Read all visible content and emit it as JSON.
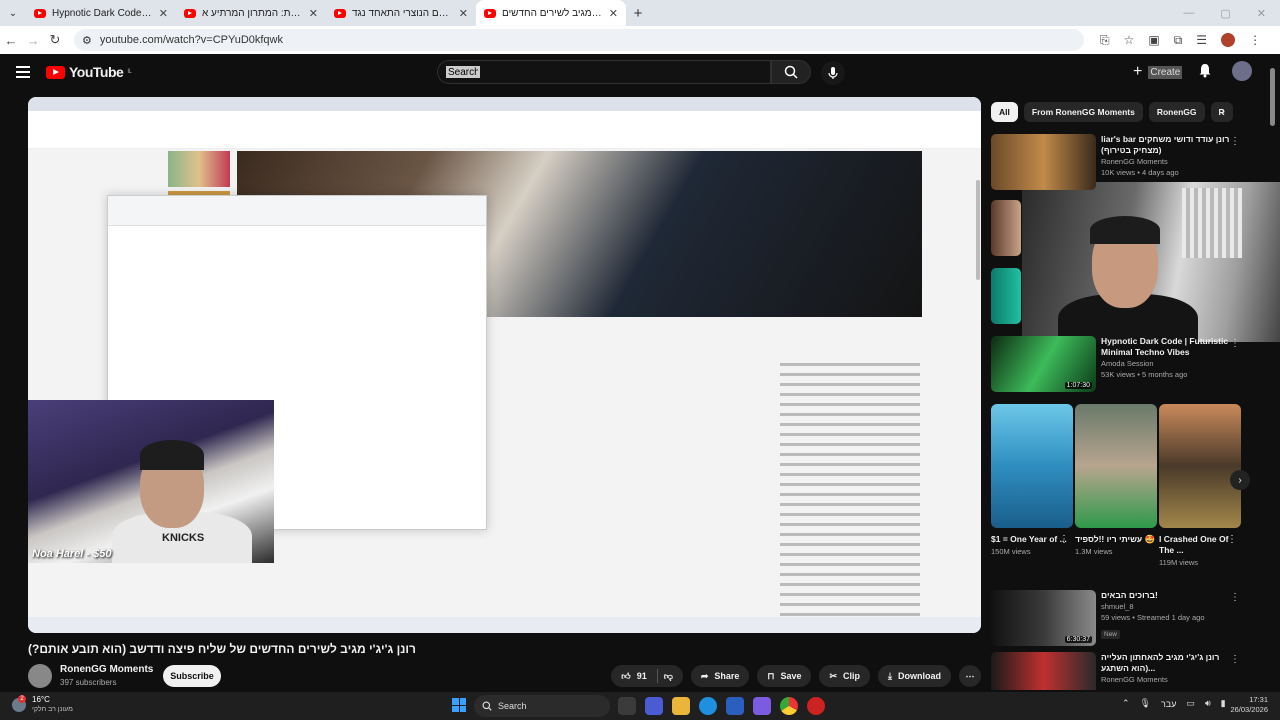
{
  "browser": {
    "tabs": [
      {
        "title": "Hypnotic Dark Code | Futuristic",
        "active": false
      },
      {
        "title": "עונש מוות: המתרון המרתיע א",
        "active": false
      },
      {
        "title": "למה העולם הנוצרי התאחד נגד",
        "active": false
      },
      {
        "title": "רונן ג'יג'י מגיב לשירים החדשים",
        "active": true
      }
    ],
    "address": "youtube.com/watch?v=CPYuD0kfqwk"
  },
  "youtube": {
    "logo_text": "YouTube",
    "logo_region": "IL",
    "search_value": "Search",
    "create_label": "Create"
  },
  "webcam_overlay": {
    "donation_text": "Noa Harel - $50",
    "shirt_text": "KNICKS"
  },
  "video": {
    "title": "רונן ג'יג'י מגיב לשירים החדשים של שליח פיצה ודדשב (הוא תובע אותם?)",
    "channel": "RonenGG Moments",
    "subscribers": "397 subscribers",
    "subscribe_label": "Subscribe",
    "likes": "91",
    "share_label": "Share",
    "save_label": "Save",
    "clip_label": "Clip",
    "download_label": "Download"
  },
  "chips": [
    "All",
    "From RonenGG Moments",
    "RonenGG",
    "R"
  ],
  "recommendations": [
    {
      "title": "liar's bar רונן עודד ודושי משחקים (מצחיק בטירוף)",
      "channel": "RonenGG Moments",
      "meta": "10K views • 4 days ago",
      "duration": ""
    },
    {
      "title": "Hypnotic Dark Code | Futuristic Minimal Techno Vibes",
      "channel": "Amoda Session",
      "meta": "53K views • 5 months ago",
      "duration": "1:07:30"
    },
    {
      "title": "ברוכים הבאים!",
      "channel": "shmuel_8",
      "meta": "59 views • Streamed 1 day ago",
      "duration": "6:30:37",
      "badge": "New"
    },
    {
      "title": "רונן ג'יג'י מגיב להאחתון העלייה (הוא השתגע...",
      "channel": "RonenGG Moments",
      "meta": "",
      "duration": ""
    }
  ],
  "shorts": [
    {
      "title": "$1 = One Year of ...",
      "views": "150M views"
    },
    {
      "title": "עשיתי ריו !!לספיד 🤩",
      "views": "1.3M views"
    },
    {
      "title": "I Crashed One Of The ...",
      "views": "119M views"
    }
  ],
  "taskbar": {
    "temperature": "16°C",
    "weather_desc": "מעונן רב חלקי",
    "weather_badge": "2",
    "search_label": "Search",
    "lang": "עבר",
    "time": "17:31",
    "date": "26/03/2026"
  }
}
